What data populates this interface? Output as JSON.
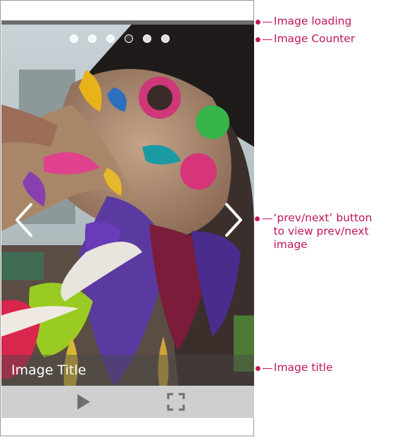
{
  "viewer": {
    "title": "Image Title",
    "counter": {
      "total": 6,
      "active_index": 3
    },
    "controls": {
      "play_icon": "play-icon",
      "fullscreen_icon": "fullscreen-icon"
    },
    "nav": {
      "prev_icon": "chevron-left-icon",
      "next_icon": "chevron-right-icon"
    }
  },
  "annotations": {
    "loading": "Image loading",
    "counter": "Image Counter",
    "prev_next_line1": "‘prev/next’ button",
    "prev_next_line2": "to view prev/next image",
    "title": "Image title"
  },
  "colors": {
    "annotation": "#c8185b",
    "controls_bar": "#cfcfcf",
    "loading_bar": "#6d6d6d"
  }
}
